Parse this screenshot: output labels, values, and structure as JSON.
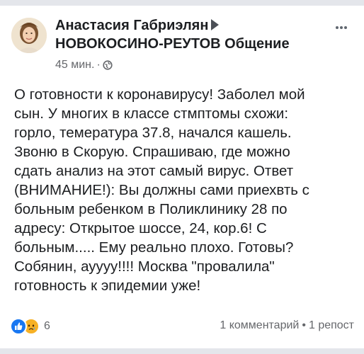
{
  "post": {
    "author": "Анастасия Габриэлян",
    "group": "НОВОКОСИНО-РЕУТОВ",
    "group_suffix": "Общение",
    "time": "45 мин.",
    "time_separator": "·",
    "privacy_icon": "globe-icon",
    "more_icon": "more-options-icon",
    "body_lines": [
      "О готовности к коронавирусу! Заболел мой",
      "сын. У многих в классе стмптомы схожи:",
      "горло, теме­ратура 37.8, начался кашель.",
      "Звоню в Скорую. Спрашиваю, где можно",
      "сдать анализ на этот самый вирус. Ответ",
      "(ВНИМАНИЕ!): Вы должны сами приехвть с",
      "больным ребенком в Поликлинику 28 по",
      "адресу: Открытое шоссе, 24, кор.6! С",
      "больным..... Ему реально плохо. Готовы?",
      "Собянин, ауууу!!!! Москва \"провалила\"",
      "готовность к эпидемии уже!"
    ]
  },
  "footer": {
    "reaction_icons": [
      "like-icon",
      "sad-icon"
    ],
    "reaction_count": "6",
    "comments": "1 комментарий",
    "separator": "•",
    "shares": "1 репост"
  },
  "colors": {
    "text": "#1c1e21",
    "secondary": "#65676b",
    "like_blue": "#1877f2",
    "sad_yellow": "#f7b125",
    "divider": "#e4e6eb"
  }
}
